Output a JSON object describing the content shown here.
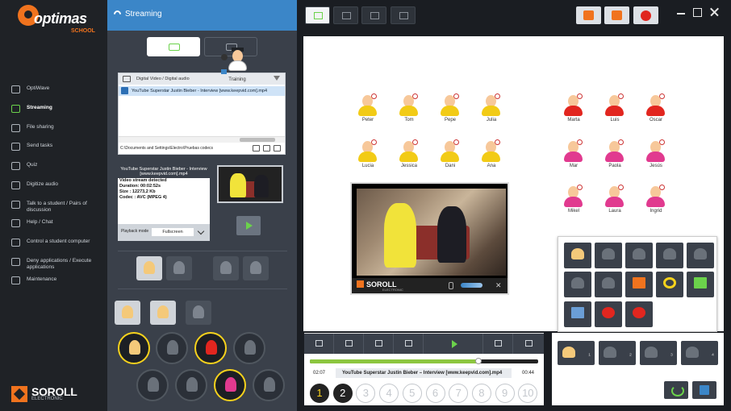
{
  "app": {
    "brand": "optimas",
    "brand_sub": "SCHOOL",
    "footer_brand": "SOROLL",
    "footer_sub": "ELECTRONIC"
  },
  "nav": [
    {
      "label": "OptiWave",
      "icon": "wave-icon"
    },
    {
      "label": "Streaming",
      "icon": "wifi-icon",
      "active": true
    },
    {
      "label": "File sharing",
      "icon": "file-share-icon"
    },
    {
      "label": "Send tasks",
      "icon": "tasks-icon"
    },
    {
      "label": "Quiz",
      "icon": "quiz-icon"
    },
    {
      "label": "Digitize audio",
      "icon": "audio-icon"
    },
    {
      "label": "Talk to a student / Pairs of discussion",
      "icon": "talk-icon"
    },
    {
      "label": "Help / Chat",
      "icon": "help-icon"
    },
    {
      "label": "Control a student computer",
      "icon": "monitor-icon"
    },
    {
      "label": "Deny applications / Execute applications",
      "icon": "deny-icon"
    },
    {
      "label": "Maintenance",
      "icon": "gear-icon"
    }
  ],
  "panel": {
    "title": "Streaming",
    "file_browser": {
      "title": "Digital Video / Digital audio",
      "selected_file": "YouTube Superstar Justin Bieber - Interview [www.keepvid.com].mp4",
      "path": "C:\\Documents and Settings\\Electro\\Pruebas codecs"
    },
    "info": {
      "title": "YouTube Superstar Justin Bieber - Interview [www.keepvid.com].mp4",
      "lines": [
        "Video stream detected",
        "Duration: 00:02:52s",
        "Size : 12273,2 Kb",
        "Codec : AVC (MPEG 4)"
      ],
      "playback_label": "Playback mode",
      "playback_value": "Fullscreen"
    }
  },
  "teacher": {
    "name": "Training"
  },
  "students": [
    {
      "name": "Peter",
      "color": "yellow"
    },
    {
      "name": "Tom",
      "color": "yellow"
    },
    {
      "name": "Pepe",
      "color": "yellow"
    },
    {
      "name": "Julia",
      "color": "yellow"
    },
    {
      "name": "Lucia",
      "color": "yellow"
    },
    {
      "name": "Jessica",
      "color": "yellow"
    },
    {
      "name": "Dani",
      "color": "yellow"
    },
    {
      "name": "Ana",
      "color": "yellow"
    },
    {
      "name": "Marta",
      "color": "red"
    },
    {
      "name": "Luis",
      "color": "red"
    },
    {
      "name": "Oscar",
      "color": "red"
    },
    {
      "name": "Mar",
      "color": "pink"
    },
    {
      "name": "Paola",
      "color": "pink"
    },
    {
      "name": "Jesús",
      "color": "pink"
    },
    {
      "name": "Mikel",
      "color": "pink"
    },
    {
      "name": "Laura",
      "color": "pink"
    },
    {
      "name": "Ingrid",
      "color": "pink"
    }
  ],
  "video_overlay": {
    "brand": "SOROLL",
    "brand_sub": "ELECTRONIC",
    "close": "✕"
  },
  "player": {
    "elapsed": "02:07",
    "file": "YouTube Superstar Justin Bieber – Interview [www.keepvid.com].mp4",
    "total": "00:44",
    "progress": 0.74,
    "channels": [
      "1",
      "2",
      "3",
      "4",
      "5",
      "6",
      "7",
      "8",
      "9",
      "10"
    ]
  },
  "groups": [
    {
      "label": "₁",
      "active": true
    },
    {
      "label": "₂"
    },
    {
      "label": "₃"
    },
    {
      "label": "₄"
    }
  ],
  "colors": {
    "accent": "#3b86c8",
    "green": "#6bd24b",
    "orange": "#f0731e",
    "yellow": "#f2cb16",
    "red": "#e2261f",
    "pink": "#e13a8f"
  }
}
